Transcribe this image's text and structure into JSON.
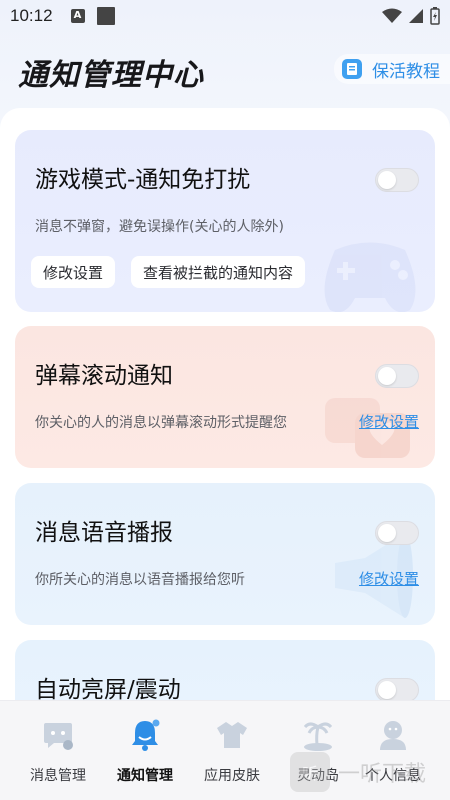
{
  "status": {
    "time": "10:12",
    "a_icon": "A"
  },
  "header": {
    "title": "通知管理中心",
    "tutorial_label": "保活教程"
  },
  "cards": [
    {
      "title": "游戏模式-通知免打扰",
      "description": "消息不弹窗，避免误操作(关心的人除外)",
      "toggle_on": false,
      "buttons": [
        "修改设置",
        "查看被拦截的通知内容"
      ]
    },
    {
      "title": "弹幕滚动通知",
      "description": "你关心的人的消息以弹幕滚动形式提醒您",
      "toggle_on": false,
      "link": "修改设置"
    },
    {
      "title": "消息语音播报",
      "description": "你所关心的消息以语音播报给您听",
      "toggle_on": false,
      "link": "修改设置"
    },
    {
      "title": "自动亮屏/震动",
      "toggle_on": false
    }
  ],
  "tabs": [
    {
      "label": "消息管理",
      "icon": "message-manage-icon",
      "active": false
    },
    {
      "label": "通知管理",
      "icon": "bell-icon",
      "active": true
    },
    {
      "label": "应用皮肤",
      "icon": "shirt-icon",
      "active": false
    },
    {
      "label": "灵动岛",
      "icon": "island-icon",
      "active": false
    },
    {
      "label": "个人信息",
      "icon": "person-icon",
      "active": false
    }
  ],
  "watermark": {
    "box_text": "听",
    "text": "一听下载"
  },
  "colors": {
    "accent": "#2e8ee6",
    "active_tab": "#2e8ee6"
  }
}
